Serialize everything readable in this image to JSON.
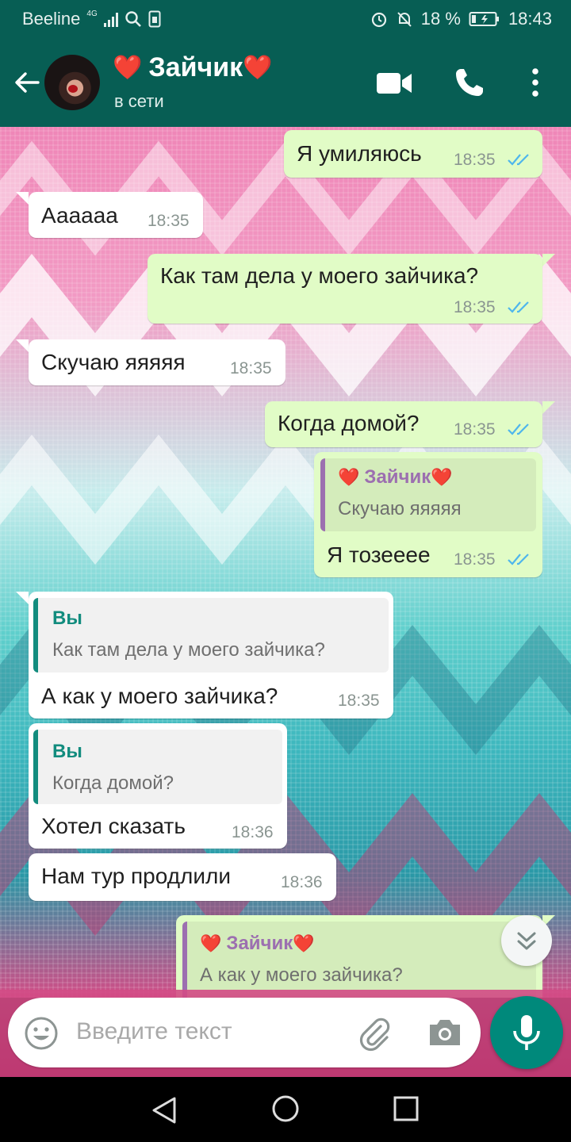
{
  "status_bar": {
    "carrier": "Beeline",
    "network": "4G",
    "battery": "18 %",
    "time": "18:43"
  },
  "header": {
    "heart_left": "❤️",
    "contact_name": "Зайчик",
    "heart_right": "❤️",
    "status": "в сети"
  },
  "messages": [
    {
      "dir": "out",
      "text": "Я умиляюсь",
      "time": "18:35",
      "read": true
    },
    {
      "dir": "in",
      "text": "Аааааа",
      "time": "18:35"
    },
    {
      "dir": "out",
      "text": "Как там дела у моего зайчика?",
      "time": "18:35",
      "read": true
    },
    {
      "dir": "in",
      "text": "Скучаю яяяяя",
      "time": "18:35"
    },
    {
      "dir": "out",
      "text": "Когда домой?",
      "time": "18:35",
      "read": true
    },
    {
      "dir": "out",
      "quote": {
        "name": "Зайчик",
        "text": "Скучаю яяяяя"
      },
      "text": "Я тозееее",
      "time": "18:35",
      "read": true
    },
    {
      "dir": "in",
      "quote": {
        "name": "Вы",
        "text": "Как там дела у моего зайчика?"
      },
      "text": "А как у моего зайчика?",
      "time": "18:35"
    },
    {
      "dir": "in",
      "quote": {
        "name": "Вы",
        "text": "Когда домой?"
      },
      "text": "Хотел сказать",
      "time": "18:36"
    },
    {
      "dir": "in",
      "text": "Нам тур продлили",
      "time": "18:36"
    },
    {
      "dir": "out",
      "quote": {
        "name": "Зайчик",
        "text": "А как у моего зайчика?"
      }
    }
  ],
  "input": {
    "placeholder": "Введите текст"
  },
  "colors": {
    "header": "#075e54",
    "outgoing_bubble": "#e1fcc6",
    "incoming_bubble": "#ffffff",
    "quote_contact_name": "#9c6fb0",
    "quote_self_name": "#128c7e",
    "read_ticks": "#4fb6ec",
    "mic_button": "#00897b"
  },
  "icons": {
    "back": "arrow-left-icon",
    "video": "video-camera-icon",
    "call": "phone-icon",
    "menu": "more-vertical-icon",
    "emoji": "emoji-icon",
    "attach": "paperclip-icon",
    "camera": "camera-icon",
    "mic": "microphone-icon",
    "scroll": "chevron-double-down-icon"
  }
}
